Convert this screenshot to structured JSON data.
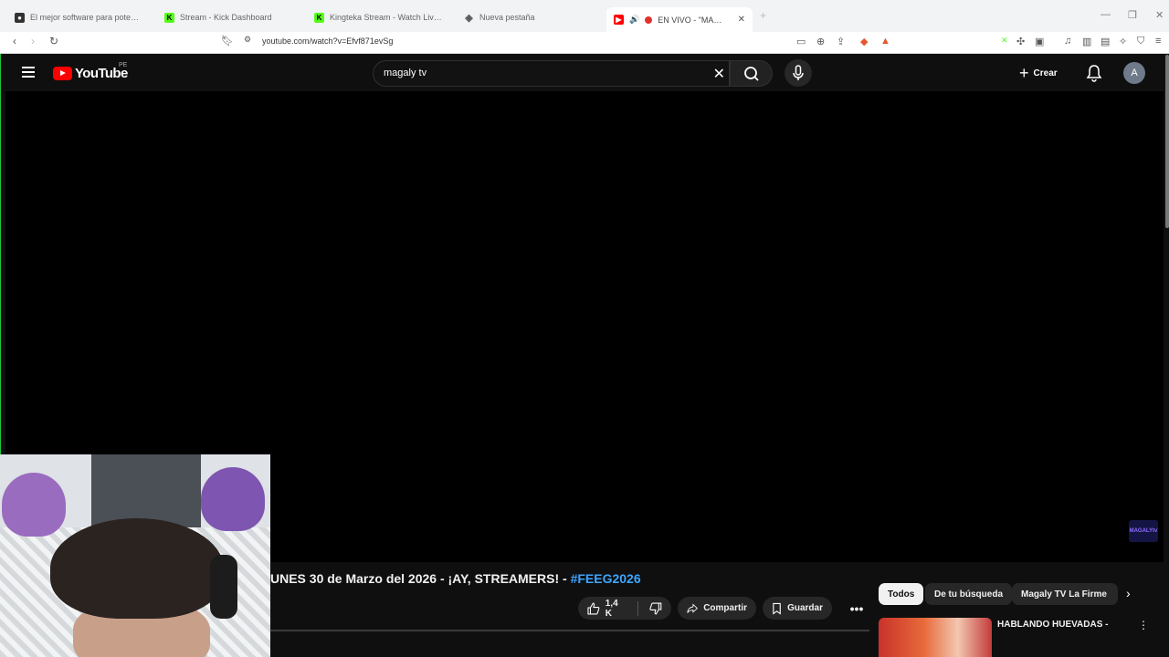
{
  "browser": {
    "tabs": [
      {
        "label": "El mejor software para potenciar tu",
        "favicon_color": "#333333",
        "favicon_char": "●"
      },
      {
        "label": "Stream - Kick Dashboard",
        "favicon_color": "#53fc18",
        "favicon_char": "K"
      },
      {
        "label": "Kingteka Stream - Watch Live on Kick",
        "favicon_color": "#53fc18",
        "favicon_char": "K"
      },
      {
        "label": "Nueva pestaña",
        "favicon_color": "#888888",
        "favicon_char": "◈"
      },
      {
        "label": "EN VIVO - \"MAGALY TV |",
        "favicon_color": "#ff0000",
        "favicon_char": "▶"
      }
    ],
    "new_tab": "+",
    "url": "youtube.com/watch?v=Efvf871evSg"
  },
  "youtube": {
    "logo_word": "YouTube",
    "region": "PE",
    "search_query": "magaly tv",
    "create_label": "Crear",
    "avatar_letter": "A"
  },
  "video": {
    "title_prefix": "UNES 30 de Marzo del 2026 - ¡AY, STREAMERS! - ",
    "title_hashtag": "#FEEG2026",
    "likes": "1,4 K",
    "share_label": "Compartir",
    "save_label": "Guardar",
    "watermark": "MAGALYtv"
  },
  "chips": [
    "Todos",
    "De tu búsqueda",
    "Magaly TV La Firme"
  ],
  "recommendation": {
    "title": "HABLANDO HUEVADAS -"
  },
  "colors": {
    "accent_red": "#ff0000",
    "hashtag_blue": "#3ea6ff",
    "kick_green": "#53fc18"
  }
}
